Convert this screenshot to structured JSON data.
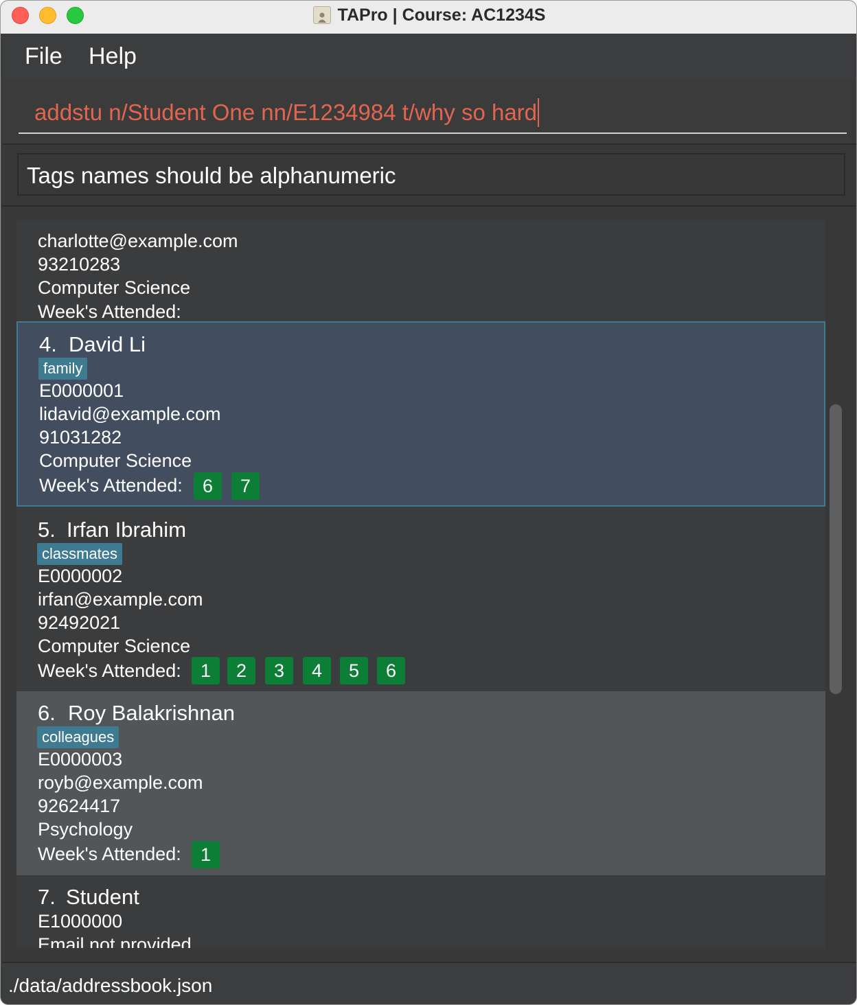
{
  "window": {
    "title": "TAPro | Course: AC1234S"
  },
  "menu": {
    "file": "File",
    "help": "Help"
  },
  "command": {
    "value": "addstu n/Student One nn/E1234984 t/why so hard"
  },
  "result": {
    "message": "Tags names should be alphanumeric"
  },
  "students": [
    {
      "email": "charlotte@example.com",
      "phone": "93210283",
      "major": "Computer Science",
      "weeks_label": "Week's Attended:",
      "weeks": []
    },
    {
      "index": "4.",
      "name": "David Li",
      "tag": "family",
      "nusnet": "E0000001",
      "email": "lidavid@example.com",
      "phone": "91031282",
      "major": "Computer Science",
      "weeks_label": "Week's Attended:",
      "weeks": [
        "6",
        "7"
      ]
    },
    {
      "index": "5.",
      "name": "Irfan Ibrahim",
      "tag": "classmates",
      "nusnet": "E0000002",
      "email": "irfan@example.com",
      "phone": "92492021",
      "major": "Computer Science",
      "weeks_label": "Week's Attended:",
      "weeks": [
        "1",
        "2",
        "3",
        "4",
        "5",
        "6"
      ]
    },
    {
      "index": "6.",
      "name": "Roy Balakrishnan",
      "tag": "colleagues",
      "nusnet": "E0000003",
      "email": "royb@example.com",
      "phone": "92624417",
      "major": "Psychology",
      "weeks_label": "Week's Attended:",
      "weeks": [
        "1"
      ]
    },
    {
      "index": "7.",
      "name": "Student",
      "nusnet": "E1000000",
      "email": "Email not provided"
    }
  ],
  "status": {
    "path": "./data/addressbook.json"
  },
  "colors": {
    "command_error_text": "#e2664f",
    "tag_background": "#3e7b91",
    "week_badge": "#0c7e35",
    "selected_card": "#424d5f"
  }
}
